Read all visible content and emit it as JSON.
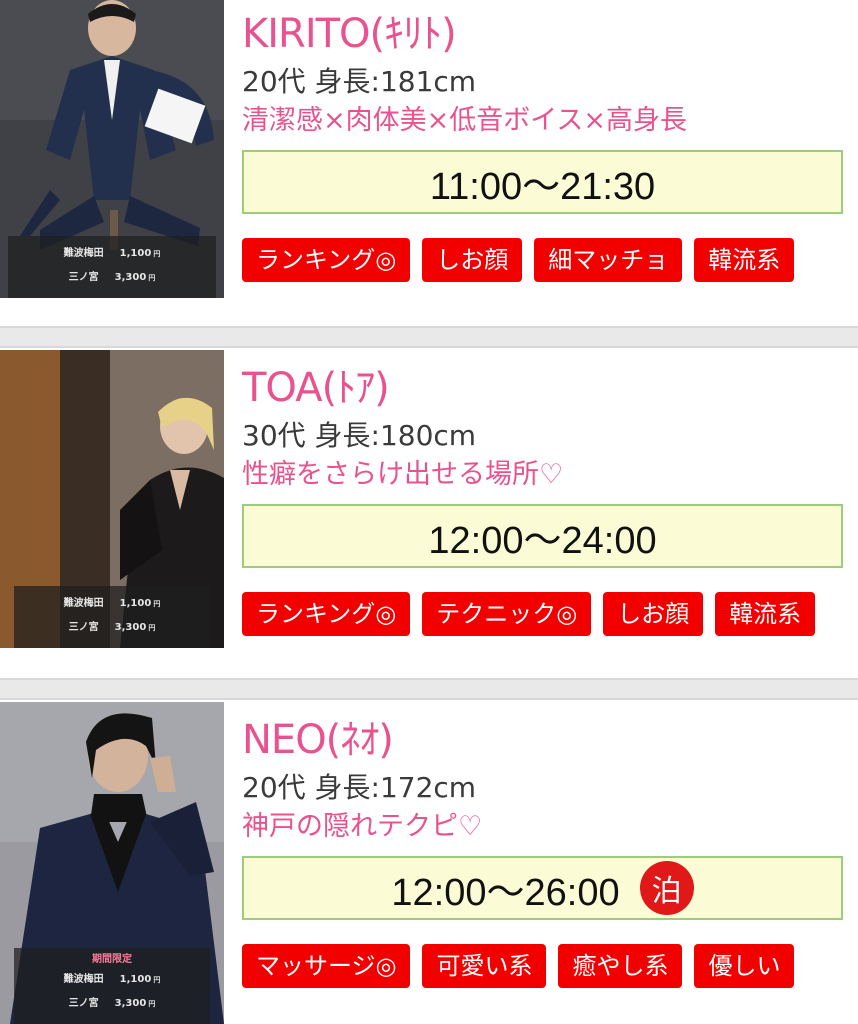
{
  "casts": [
    {
      "name": "KIRITO(ｷﾘﾄ)",
      "age_height": "20代 身長:181cm",
      "catchphrase": "清潔感×肉体美×低音ボイス×高身長",
      "hours": "11:00〜21:30",
      "stay_badge": "",
      "limited": "",
      "prices": [
        {
          "area": "難波梅田",
          "price": "1,100",
          "unit": "円"
        },
        {
          "area": "三ノ宮",
          "price": "3,300",
          "unit": "円"
        }
      ],
      "tags": [
        "ランキング◎",
        "しお顔",
        "細マッチョ",
        "韓流系"
      ]
    },
    {
      "name": "TOA(ﾄｱ)",
      "age_height": "30代 身長:180cm",
      "catchphrase": "性癖をさらけ出せる場所♡",
      "hours": "12:00〜24:00",
      "stay_badge": "",
      "limited": "",
      "prices": [
        {
          "area": "難波梅田",
          "price": "1,100",
          "unit": "円"
        },
        {
          "area": "三ノ宮",
          "price": "3,300",
          "unit": "円"
        }
      ],
      "tags": [
        "ランキング◎",
        "テクニック◎",
        "しお顔",
        "韓流系"
      ]
    },
    {
      "name": "NEO(ﾈｵ)",
      "age_height": "20代 身長:172cm",
      "catchphrase": "神戸の隠れテクピ♡",
      "hours": "12:00〜26:00",
      "stay_badge": "泊",
      "limited": "期間限定",
      "prices": [
        {
          "area": "難波梅田",
          "price": "1,100",
          "unit": "円"
        },
        {
          "area": "三ノ宮",
          "price": "3,300",
          "unit": "円"
        }
      ],
      "tags": [
        "マッサージ◎",
        "可愛い系",
        "癒やし系",
        "優しい"
      ]
    }
  ]
}
